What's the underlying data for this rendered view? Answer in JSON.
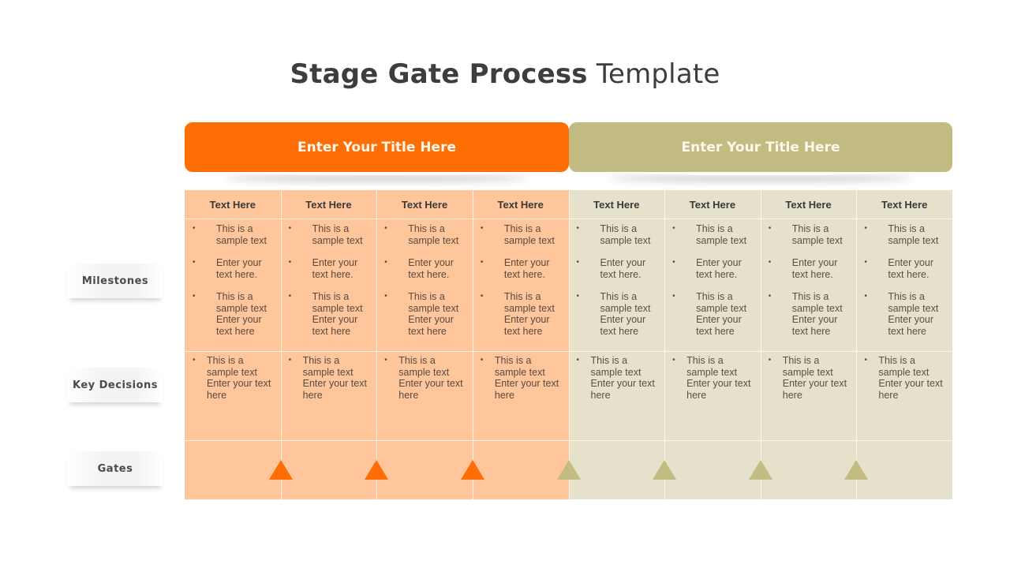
{
  "title": {
    "bold": "Stage Gate Process",
    "light": "Template"
  },
  "colors": {
    "orange": "#ff6d05",
    "orange_light": "#ffc59b",
    "olive": "#c2bb82",
    "olive_light": "#e5e1cb"
  },
  "phases": [
    {
      "label": "Enter Your Title Here"
    },
    {
      "label": "Enter Your Title Here"
    }
  ],
  "row_labels": {
    "milestones": "Milestones",
    "key_decisions": "Key Decisions",
    "gates": "Gates"
  },
  "columns": [
    {
      "header": "Text Here",
      "phase": 0,
      "milestones": [
        "This is a sample text",
        "Enter your text here.",
        "This is a sample text Enter your text here"
      ],
      "key_decision": "This is a sample text Enter your text here"
    },
    {
      "header": "Text Here",
      "phase": 0,
      "milestones": [
        "This is a sample text",
        "Enter your text here.",
        "This is a sample text Enter your text here"
      ],
      "key_decision": "This is a sample text Enter your text here"
    },
    {
      "header": "Text Here",
      "phase": 0,
      "milestones": [
        "This is a sample text",
        "Enter your text here.",
        "This is a sample text Enter your text here"
      ],
      "key_decision": "This is a sample text Enter your text here"
    },
    {
      "header": "Text Here",
      "phase": 0,
      "milestones": [
        "This is a sample text",
        "Enter your text here.",
        "This is a sample text Enter your text here"
      ],
      "key_decision": "This is a sample text Enter your text here"
    },
    {
      "header": "Text Here",
      "phase": 1,
      "milestones": [
        "This is a sample text",
        "Enter your text here.",
        "This is a sample text Enter your text here"
      ],
      "key_decision": "This is a sample text Enter your text here"
    },
    {
      "header": "Text Here",
      "phase": 1,
      "milestones": [
        "This is a sample text",
        "Enter your text here.",
        "This is a sample text Enter your text here"
      ],
      "key_decision": "This is a sample text Enter your text here"
    },
    {
      "header": "Text Here",
      "phase": 1,
      "milestones": [
        "This is a sample text",
        "Enter your text here.",
        "This is a sample text Enter your text here"
      ],
      "key_decision": "This is a sample text Enter your text here"
    },
    {
      "header": "Text Here",
      "phase": 1,
      "milestones": [
        "This is a sample text",
        "Enter your text here.",
        "This is a sample text Enter your text here"
      ],
      "key_decision": "This is a sample text Enter your text here"
    }
  ],
  "gates": [
    {
      "phase": 0
    },
    {
      "phase": 0
    },
    {
      "phase": 0
    },
    {
      "phase": 1
    },
    {
      "phase": 1
    },
    {
      "phase": 1
    },
    {
      "phase": 1
    }
  ],
  "bullet": "•"
}
